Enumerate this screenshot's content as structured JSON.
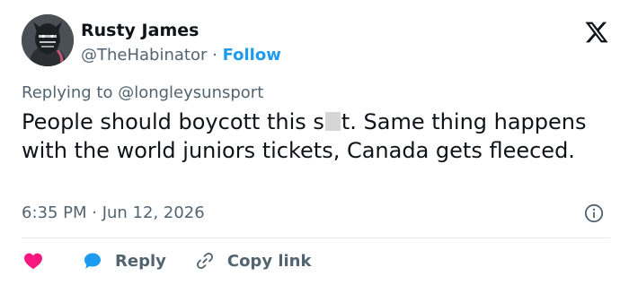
{
  "author": {
    "display_name": "Rusty James",
    "handle": "@TheHabinator",
    "separator": " · ",
    "follow_label": "Follow"
  },
  "reply_context": {
    "prefix": "Replying to ",
    "mention": "@longleysunsport"
  },
  "tweet": {
    "text_part1": "People should boycott this s",
    "text_part2": "t. Same thing happens with the world juniors tickets, Canada gets fleeced."
  },
  "timestamp": "6:35 PM · Jun 12, 2026",
  "actions": {
    "reply_label": "Reply",
    "copy_link_label": "Copy link"
  },
  "icons": {
    "logo": "x-logo-icon",
    "info": "info-icon",
    "like": "heart-icon",
    "reply": "speech-bubble-icon",
    "copy": "link-icon"
  },
  "colors": {
    "accent": "#1d9bf0",
    "heart": "#f91880",
    "muted": "#536471",
    "text": "#0f1419"
  }
}
